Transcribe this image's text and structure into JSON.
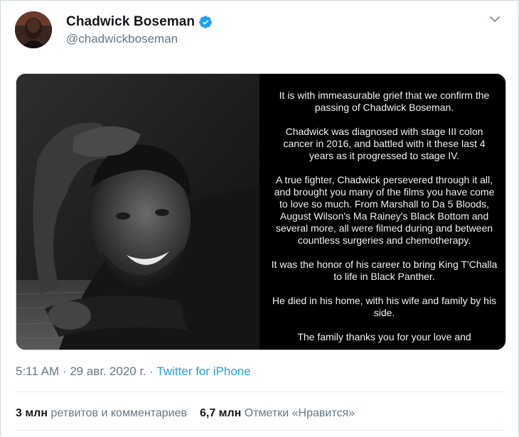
{
  "tweet": {
    "author": {
      "display_name": "Chadwick Boseman",
      "handle": "@chadwickboseman",
      "verified": true,
      "avatar_icon": "profile-photo"
    },
    "media": {
      "photo_description_icon": "portrait-photo",
      "statement_paragraphs": [
        "It is with immeasurable grief that we confirm the passing of Chadwick Boseman.",
        "Chadwick was diagnosed with stage III colon cancer in 2016, and battled with it these last 4 years as it progressed to stage IV.",
        "A true fighter, Chadwick persevered through it all, and brought you many of the films you have come to love so much. From Marshall to Da 5 Bloods, August Wilson's Ma Rainey's Black Bottom and several more, all were filmed during and between countless surgeries and chemotherapy.",
        "It was the honor of his career to bring King T'Challa to life in Black Panther.",
        "He died in his home, with his wife and family by his side.",
        "The family thanks you for your love and"
      ]
    },
    "timestamp": "5:11 AM · 29 авг. 2020 г.",
    "separator": " · ",
    "source": "Twitter for iPhone",
    "stats": {
      "retweets_count": "3 млн",
      "retweets_label": "ретвитов и комментариев",
      "likes_count": "6,7 млн",
      "likes_label": "Отметки «Нравится»"
    }
  },
  "colors": {
    "accent": "#1da1f2",
    "text_primary": "#14171a",
    "text_secondary": "#657786",
    "verified_badge": "#1da1f2",
    "statement_bg": "#000000"
  }
}
